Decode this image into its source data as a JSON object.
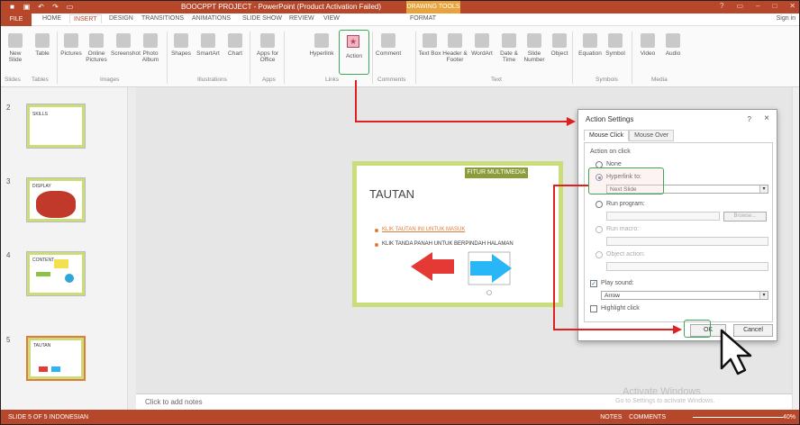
{
  "titlebar": {
    "title": "BOOCPPT PROJECT - PowerPoint (Product Activation Failed)",
    "context_tab": "DRAWING TOOLS"
  },
  "tabs": [
    "FILE",
    "HOME",
    "INSERT",
    "DESIGN",
    "TRANSITIONS",
    "ANIMATIONS",
    "SLIDE SHOW",
    "REVIEW",
    "VIEW",
    "FORMAT"
  ],
  "active_tab": "INSERT",
  "signin": "Sign in",
  "ribbon": {
    "buttons": [
      "New Slide",
      "Table",
      "Pictures",
      "Online Pictures",
      "Screenshot",
      "Photo Album",
      "Shapes",
      "SmartArt",
      "Chart",
      "Apps for Office",
      "Hyperlink",
      "Action",
      "Comment",
      "Text Box",
      "Header & Footer",
      "WordArt",
      "Date & Time",
      "Slide Number",
      "Object",
      "Equation",
      "Symbol",
      "Video",
      "Audio"
    ],
    "groups": [
      "Slides",
      "Tables",
      "Images",
      "Illustrations",
      "Apps",
      "Links",
      "Comments",
      "Text",
      "Symbols",
      "Media"
    ]
  },
  "slides": {
    "numbers": [
      "2",
      "3",
      "4",
      "5"
    ],
    "thumb_titles": [
      "SKILLS",
      "DISPLAY",
      "CONTENT",
      "TAUTAN"
    ]
  },
  "slide": {
    "tag": "FITUR MULTIMEDIA",
    "title": "TAUTAN",
    "bullet1": "KLIK TAUTAN INI UNTUK MASUK",
    "bullet2": "KLIK TANDA PANAH UNTUK BERPINDAH HALAMAN"
  },
  "notes_placeholder": "Click to add notes",
  "dialog": {
    "title": "Action Settings",
    "help": "?",
    "close": "×",
    "tab_mouse_click": "Mouse Click",
    "tab_mouse_over": "Mouse Over",
    "section": "Action on click",
    "opt_none": "None",
    "opt_hyperlink": "Hyperlink to:",
    "hyperlink_value": "Next Slide",
    "opt_run_program": "Run program:",
    "browse": "Browse...",
    "opt_run_macro": "Run macro:",
    "opt_object_action": "Object action:",
    "play_sound_label": "Play sound:",
    "play_sound_value": "Arrow",
    "highlight_click": "Highlight click",
    "ok": "OK",
    "cancel": "Cancel"
  },
  "status": {
    "left": "SLIDE 5 OF 5    INDONESIAN",
    "notes": "NOTES",
    "comments": "COMMENTS",
    "zoom": "40%"
  },
  "watermark": {
    "line1": "Activate Windows",
    "line2": "Go to Settings to activate Windows."
  },
  "colors": {
    "accent": "#b7472a",
    "highlight": "#3ca85a",
    "annotation": "#e02020"
  }
}
